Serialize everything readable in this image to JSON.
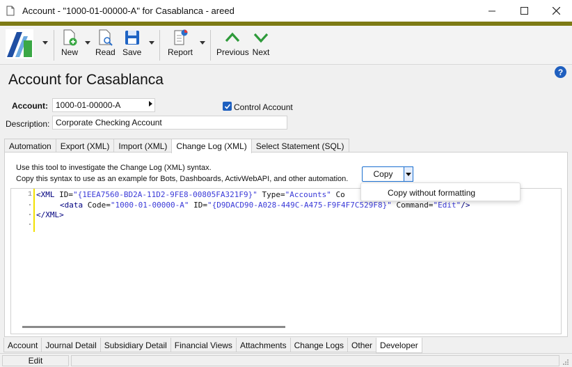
{
  "window": {
    "title": "Account - \"1000-01-00000-A\" for Casablanca - areed"
  },
  "toolbar": {
    "new_label": "New",
    "read_label": "Read",
    "save_label": "Save",
    "report_label": "Report",
    "previous_label": "Previous",
    "next_label": "Next"
  },
  "page": {
    "title": "Account for Casablanca"
  },
  "form": {
    "account_label": "Account:",
    "account_value": "1000-01-00000-A",
    "control_account_label": "Control Account",
    "control_account_checked": true,
    "description_label": "Description:",
    "description_value": "Corporate Checking Account"
  },
  "top_tabs": [
    {
      "label": "Automation",
      "active": false
    },
    {
      "label": "Export (XML)",
      "active": false
    },
    {
      "label": "Import (XML)",
      "active": false
    },
    {
      "label": "Change Log (XML)",
      "active": true
    },
    {
      "label": "Select Statement (SQL)",
      "active": false
    }
  ],
  "panel": {
    "info_line1": "Use this tool to investigate the Change Log (XML) syntax.",
    "info_line2": "Copy this syntax to use as an example for Bots, Dashboards, ActivWebAPI, and other automation.",
    "copy_label": "Copy",
    "copy_menu_item": "Copy without formatting"
  },
  "code": {
    "line_number": "1",
    "line1": {
      "open": "<XML ",
      "attr1": "ID=",
      "val1": "\"{1EEA7560-BD2A-11D2-9FE8-00805FA321F9}\"",
      "attr2": " Type=",
      "val2": "\"Accounts\"",
      "rest": " Co"
    },
    "line2": {
      "open": "<data ",
      "attr1": "Code=",
      "val1": "\"1000-01-00000-A\"",
      "attr2": " ID=",
      "val2": "\"{D9DACD90-A028-449C-A475-F9F4F7C529F8}\"",
      "attr3": " Command=",
      "val3": "\"Edit\"",
      "close": "/>"
    },
    "line3": "</XML>"
  },
  "bottom_tabs": [
    {
      "label": "Account",
      "active": false
    },
    {
      "label": "Journal Detail",
      "active": false
    },
    {
      "label": "Subsidiary Detail",
      "active": false
    },
    {
      "label": "Financial Views",
      "active": false
    },
    {
      "label": "Attachments",
      "active": false
    },
    {
      "label": "Change Logs",
      "active": false
    },
    {
      "label": "Other",
      "active": false
    },
    {
      "label": "Developer",
      "active": true
    }
  ],
  "status": {
    "mode": "Edit"
  },
  "colors": {
    "brand_band": "#7d7a14",
    "accent_blue": "#1a6fd0",
    "nav_green": "#2e9a3a"
  }
}
